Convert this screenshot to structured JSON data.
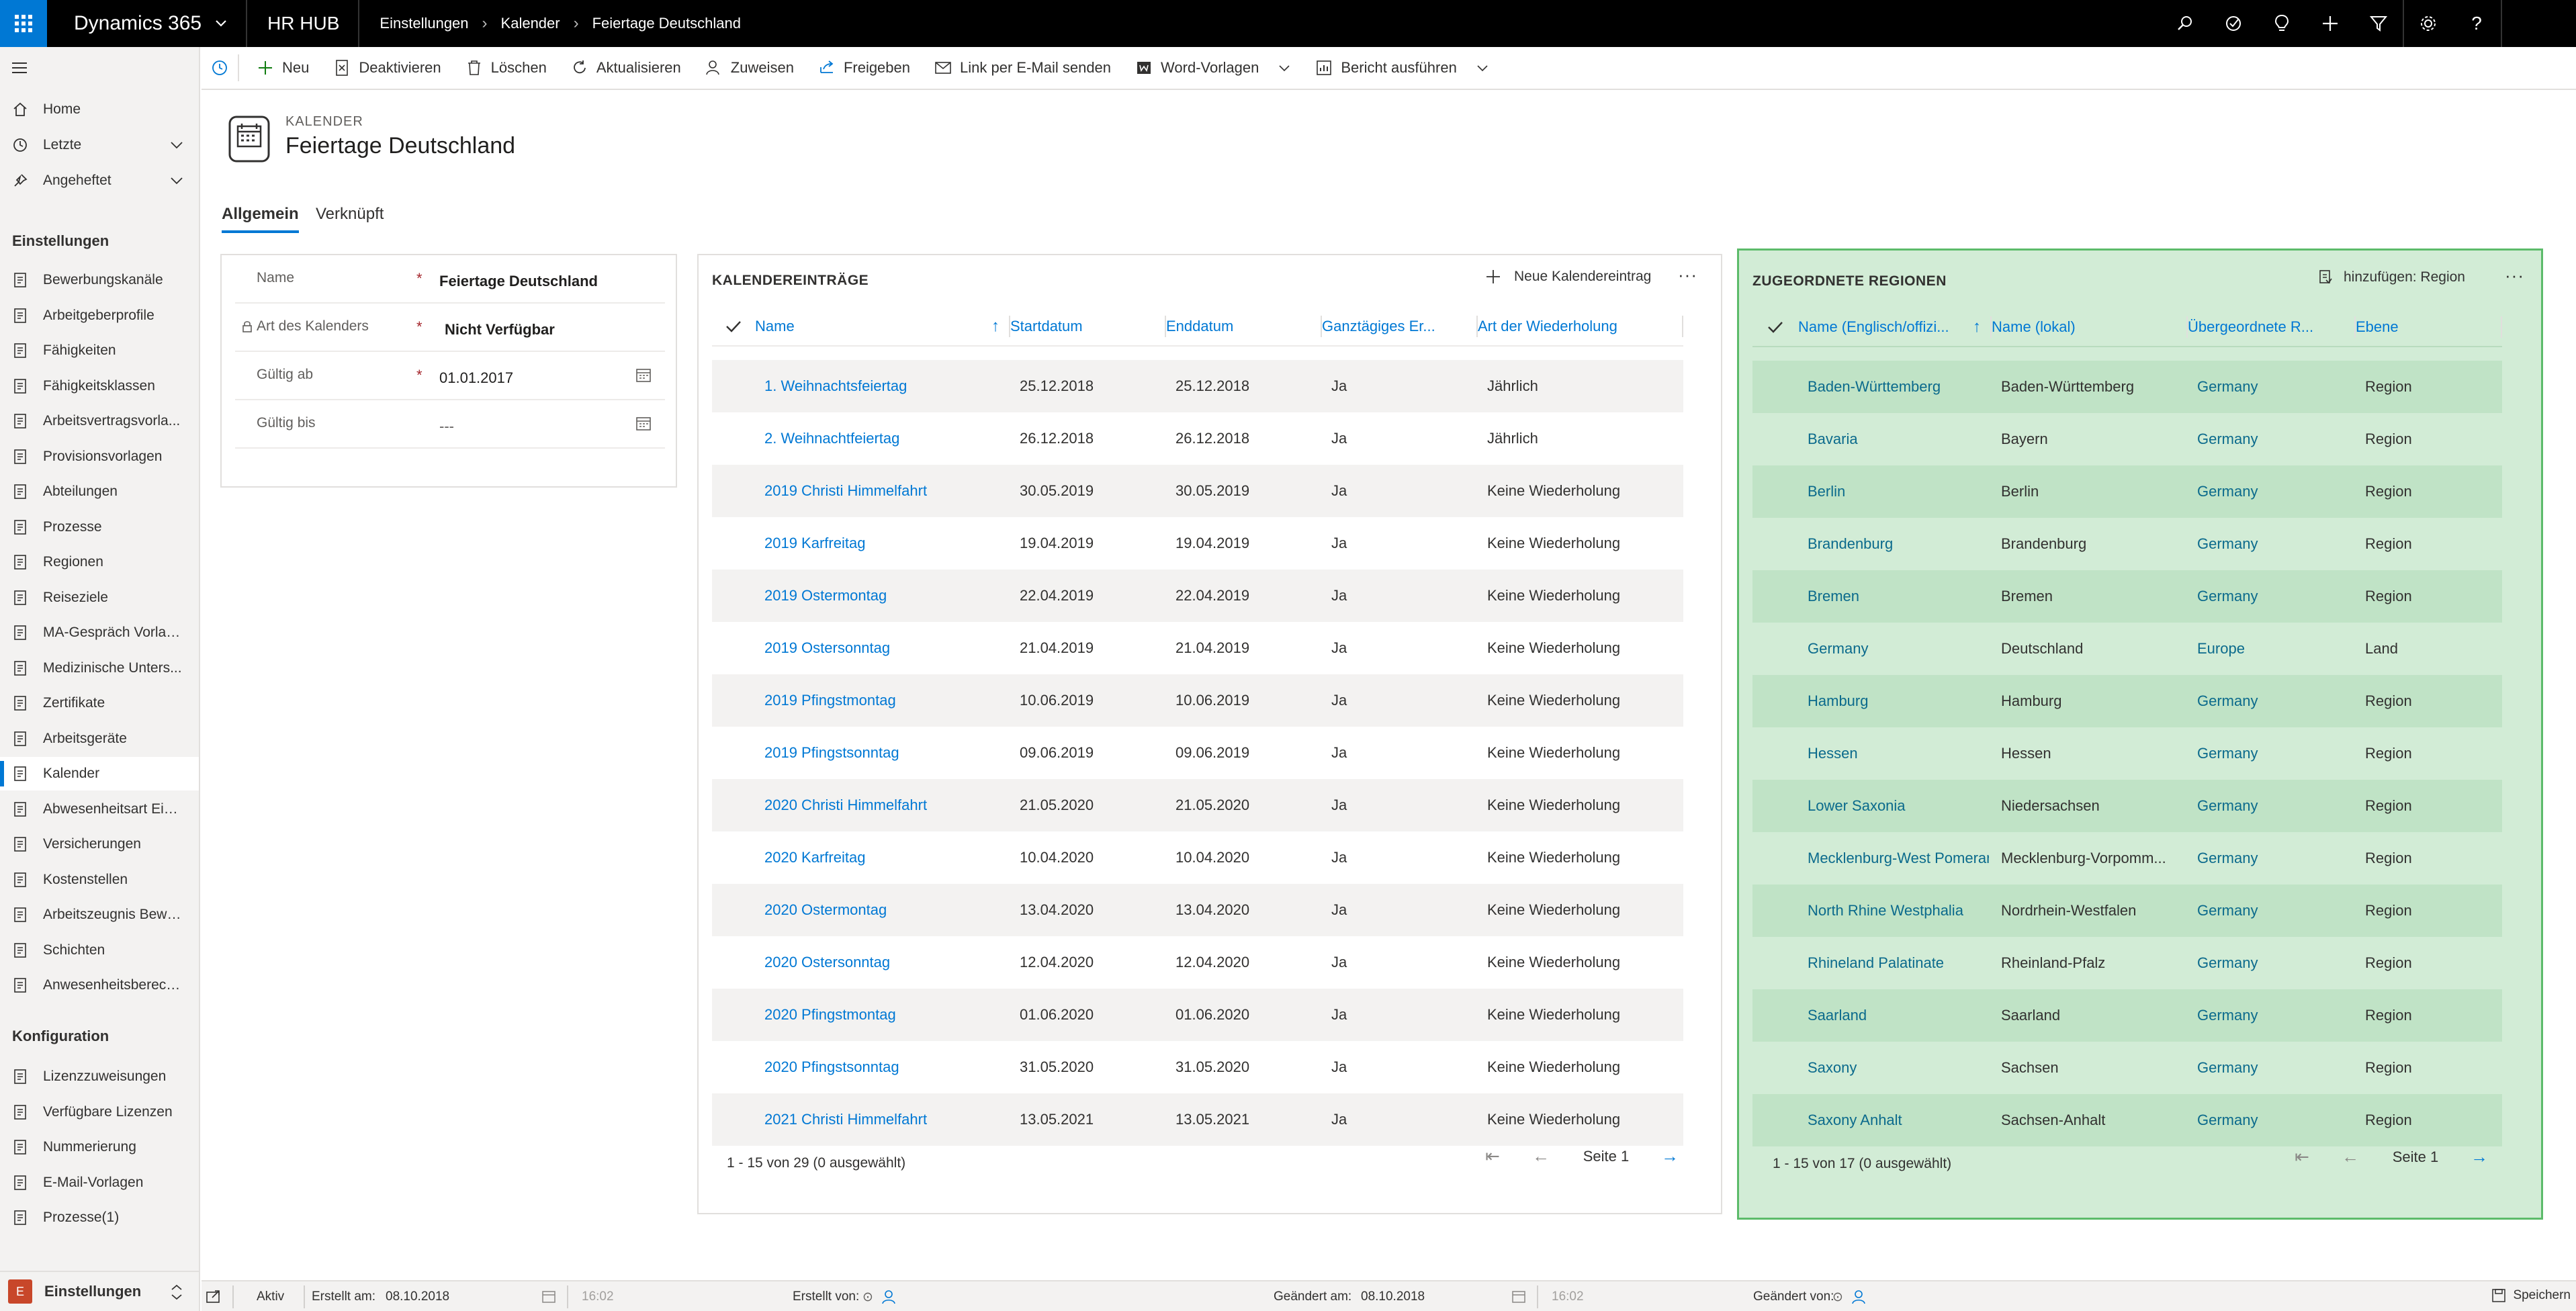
{
  "topbar": {
    "product": "Dynamics 365",
    "app": "HR HUB",
    "breadcrumb": [
      "Einstellungen",
      "Kalender",
      "Feiertage Deutschland"
    ],
    "right_icons": [
      "search-icon",
      "task-icon",
      "lightbulb-icon",
      "plus-icon",
      "filter-icon",
      "gear-icon",
      "help-icon"
    ]
  },
  "nav": {
    "top": [
      {
        "label": "Home",
        "icon": "home-icon"
      },
      {
        "label": "Letzte",
        "icon": "clock-icon",
        "chevron": true
      },
      {
        "label": "Angeheftet",
        "icon": "pin-icon",
        "chevron": true
      }
    ],
    "group1": "Einstellungen",
    "items1": [
      {
        "label": "Bewerbungskanäle"
      },
      {
        "label": "Arbeitgeberprofile"
      },
      {
        "label": "Fähigkeiten"
      },
      {
        "label": "Fähigkeitsklassen"
      },
      {
        "label": "Arbeitsvertragsvorla..."
      },
      {
        "label": "Provisionsvorlagen"
      },
      {
        "label": "Abteilungen"
      },
      {
        "label": "Prozesse"
      },
      {
        "label": "Regionen"
      },
      {
        "label": "Reiseziele"
      },
      {
        "label": "MA-Gespräch Vorlag..."
      },
      {
        "label": "Medizinische Unters..."
      },
      {
        "label": "Zertifikate"
      },
      {
        "label": "Arbeitsgeräte"
      },
      {
        "label": "Kalender",
        "selected": true
      },
      {
        "label": "Abwesenheitsart Eins..."
      },
      {
        "label": "Versicherungen"
      },
      {
        "label": "Kostenstellen"
      },
      {
        "label": "Arbeitszeugnis Bewe..."
      },
      {
        "label": "Schichten"
      },
      {
        "label": "Anwesenheitsberech..."
      }
    ],
    "group2": "Konfiguration",
    "items2": [
      {
        "label": "Lizenzzuweisungen"
      },
      {
        "label": "Verfügbare Lizenzen"
      },
      {
        "label": "Nummerierung"
      },
      {
        "label": "E-Mail-Vorlagen"
      },
      {
        "label": "Prozesse(1)"
      }
    ],
    "area": {
      "badge": "E",
      "label": "Einstellungen"
    }
  },
  "commands": [
    {
      "label": "",
      "icon": "history-icon"
    },
    {
      "label": "Neu",
      "icon": "plus-icon"
    },
    {
      "label": "Deaktivieren",
      "icon": "deactivate-icon"
    },
    {
      "label": "Löschen",
      "icon": "trash-icon"
    },
    {
      "label": "Aktualisieren",
      "icon": "refresh-icon"
    },
    {
      "label": "Zuweisen",
      "icon": "assign-icon"
    },
    {
      "label": "Freigeben",
      "icon": "share-icon"
    },
    {
      "label": "Link per E-Mail senden",
      "icon": "mail-icon"
    },
    {
      "label": "Word-Vorlagen",
      "icon": "word-icon",
      "chevron": true
    },
    {
      "label": "Bericht ausführen",
      "icon": "report-icon",
      "chevron": true
    }
  ],
  "header": {
    "entity": "KALENDER",
    "title": "Feiertage Deutschland"
  },
  "tabs": [
    "Allgemein",
    "Verknüpft"
  ],
  "form": {
    "fields": [
      {
        "label": "Name",
        "required": "*",
        "value": "Feiertage Deutschland"
      },
      {
        "label": "Art des Kalenders",
        "required": "*",
        "value": "Nicht Verfügbar"
      },
      {
        "label": "Gültig ab",
        "required": "*",
        "value": "01.01.2017"
      },
      {
        "label": "Gültig bis",
        "required": "",
        "value": "---"
      }
    ]
  },
  "entries": {
    "title": "KALENDEREINTRÄGE",
    "new_label": "Neue Kalendereintrag",
    "columns": [
      "Name",
      "Startdatum",
      "Enddatum",
      "Ganztägiges Er...",
      "Art der Wiederholung"
    ],
    "rows": [
      [
        "1. Weihnachtsfeiertag",
        "25.12.2018",
        "25.12.2018",
        "Ja",
        "Jährlich"
      ],
      [
        "2. Weihnachtfeiertag",
        "26.12.2018",
        "26.12.2018",
        "Ja",
        "Jährlich"
      ],
      [
        "2019 Christi Himmelfahrt",
        "30.05.2019",
        "30.05.2019",
        "Ja",
        "Keine Wiederholung"
      ],
      [
        "2019 Karfreitag",
        "19.04.2019",
        "19.04.2019",
        "Ja",
        "Keine Wiederholung"
      ],
      [
        "2019 Ostermontag",
        "22.04.2019",
        "22.04.2019",
        "Ja",
        "Keine Wiederholung"
      ],
      [
        "2019 Ostersonntag",
        "21.04.2019",
        "21.04.2019",
        "Ja",
        "Keine Wiederholung"
      ],
      [
        "2019 Pfingstmontag",
        "10.06.2019",
        "10.06.2019",
        "Ja",
        "Keine Wiederholung"
      ],
      [
        "2019 Pfingstsonntag",
        "09.06.2019",
        "09.06.2019",
        "Ja",
        "Keine Wiederholung"
      ],
      [
        "2020 Christi Himmelfahrt",
        "21.05.2020",
        "21.05.2020",
        "Ja",
        "Keine Wiederholung"
      ],
      [
        "2020 Karfreitag",
        "10.04.2020",
        "10.04.2020",
        "Ja",
        "Keine Wiederholung"
      ],
      [
        "2020 Ostermontag",
        "13.04.2020",
        "13.04.2020",
        "Ja",
        "Keine Wiederholung"
      ],
      [
        "2020 Ostersonntag",
        "12.04.2020",
        "12.04.2020",
        "Ja",
        "Keine Wiederholung"
      ],
      [
        "2020 Pfingstmontag",
        "01.06.2020",
        "01.06.2020",
        "Ja",
        "Keine Wiederholung"
      ],
      [
        "2020 Pfingstsonntag",
        "31.05.2020",
        "31.05.2020",
        "Ja",
        "Keine Wiederholung"
      ],
      [
        "2021 Christi Himmelfahrt",
        "13.05.2021",
        "13.05.2021",
        "Ja",
        "Keine Wiederholung"
      ]
    ],
    "footer": "1 - 15 von 29 (0 ausgewählt)",
    "page": "Seite 1"
  },
  "regions": {
    "title": "ZUGEORDNETE REGIONEN",
    "add_label": "hinzufügen: Region",
    "columns": [
      "Name (Englisch/offizi...",
      "Name (lokal)",
      "Übergeordnete R...",
      "Ebene"
    ],
    "rows": [
      [
        "Baden-Württemberg",
        "Baden-Württemberg",
        "Germany",
        "Region"
      ],
      [
        "Bavaria",
        "Bayern",
        "Germany",
        "Region"
      ],
      [
        "Berlin",
        "Berlin",
        "Germany",
        "Region"
      ],
      [
        "Brandenburg",
        "Brandenburg",
        "Germany",
        "Region"
      ],
      [
        "Bremen",
        "Bremen",
        "Germany",
        "Region"
      ],
      [
        "Germany",
        "Deutschland",
        "Europe",
        "Land"
      ],
      [
        "Hamburg",
        "Hamburg",
        "Germany",
        "Region"
      ],
      [
        "Hessen",
        "Hessen",
        "Germany",
        "Region"
      ],
      [
        "Lower Saxonia",
        "Niedersachsen",
        "Germany",
        "Region"
      ],
      [
        "Mecklenburg-West Pomerania",
        "Mecklenburg-Vorpomm...",
        "Germany",
        "Region"
      ],
      [
        "North Rhine Westphalia",
        "Nordrhein-Westfalen",
        "Germany",
        "Region"
      ],
      [
        "Rhineland Palatinate",
        "Rheinland-Pfalz",
        "Germany",
        "Region"
      ],
      [
        "Saarland",
        "Saarland",
        "Germany",
        "Region"
      ],
      [
        "Saxony",
        "Sachsen",
        "Germany",
        "Region"
      ],
      [
        "Saxony Anhalt",
        "Sachsen-Anhalt",
        "Germany",
        "Region"
      ]
    ],
    "footer": "1 - 15 von 17 (0 ausgewählt)",
    "page": "Seite 1"
  },
  "footer": {
    "status": "Aktiv",
    "created_on_label": "Erstellt am:",
    "created_on": "08.10.2018",
    "created_time": "16:02",
    "created_by_label": "Erstellt von:",
    "modified_on_label": "Geändert am:",
    "modified_on": "08.10.2018",
    "modified_time": "16:02",
    "modified_by_label": "Geändert von:",
    "save_label": "Speichern"
  },
  "colors": {
    "accent": "#0078d4",
    "topbar": "#000000",
    "highlight_fill": "#d2ecd6",
    "highlight_border": "#5cbb6a"
  }
}
